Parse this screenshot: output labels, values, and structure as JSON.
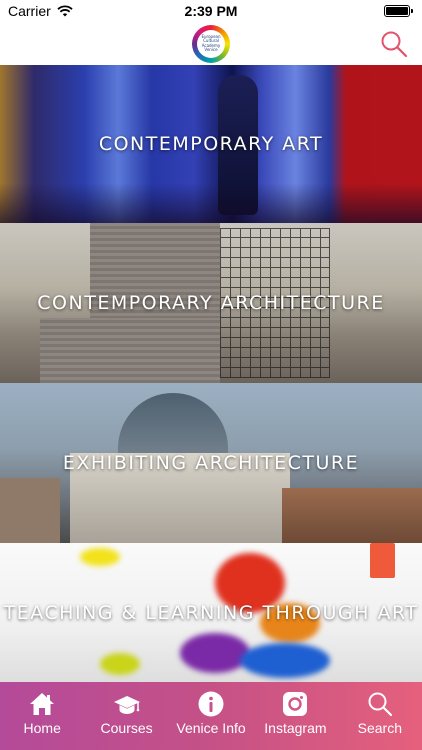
{
  "status": {
    "carrier": "Carrier",
    "time": "2:39 PM"
  },
  "header": {
    "logo_lines": [
      "European",
      "Cultural",
      "Academy",
      "Venice"
    ],
    "search_icon": "search-icon"
  },
  "tiles": [
    {
      "title": "CONTEMPORARY ART"
    },
    {
      "title": "CONTEMPORARY ARCHITECTURE"
    },
    {
      "title": "EXHIBITING ARCHITECTURE"
    },
    {
      "title": "TEACHING & LEARNING THROUGH ART"
    }
  ],
  "tabbar": {
    "gradient": [
      "#b44a9a",
      "#e5607c"
    ],
    "items": [
      {
        "label": "Home",
        "icon": "home-icon"
      },
      {
        "label": "Courses",
        "icon": "graduation-cap-icon"
      },
      {
        "label": "Venice Info",
        "icon": "info-icon"
      },
      {
        "label": "Instagram",
        "icon": "instagram-icon"
      },
      {
        "label": "Search",
        "icon": "search-icon"
      }
    ]
  }
}
